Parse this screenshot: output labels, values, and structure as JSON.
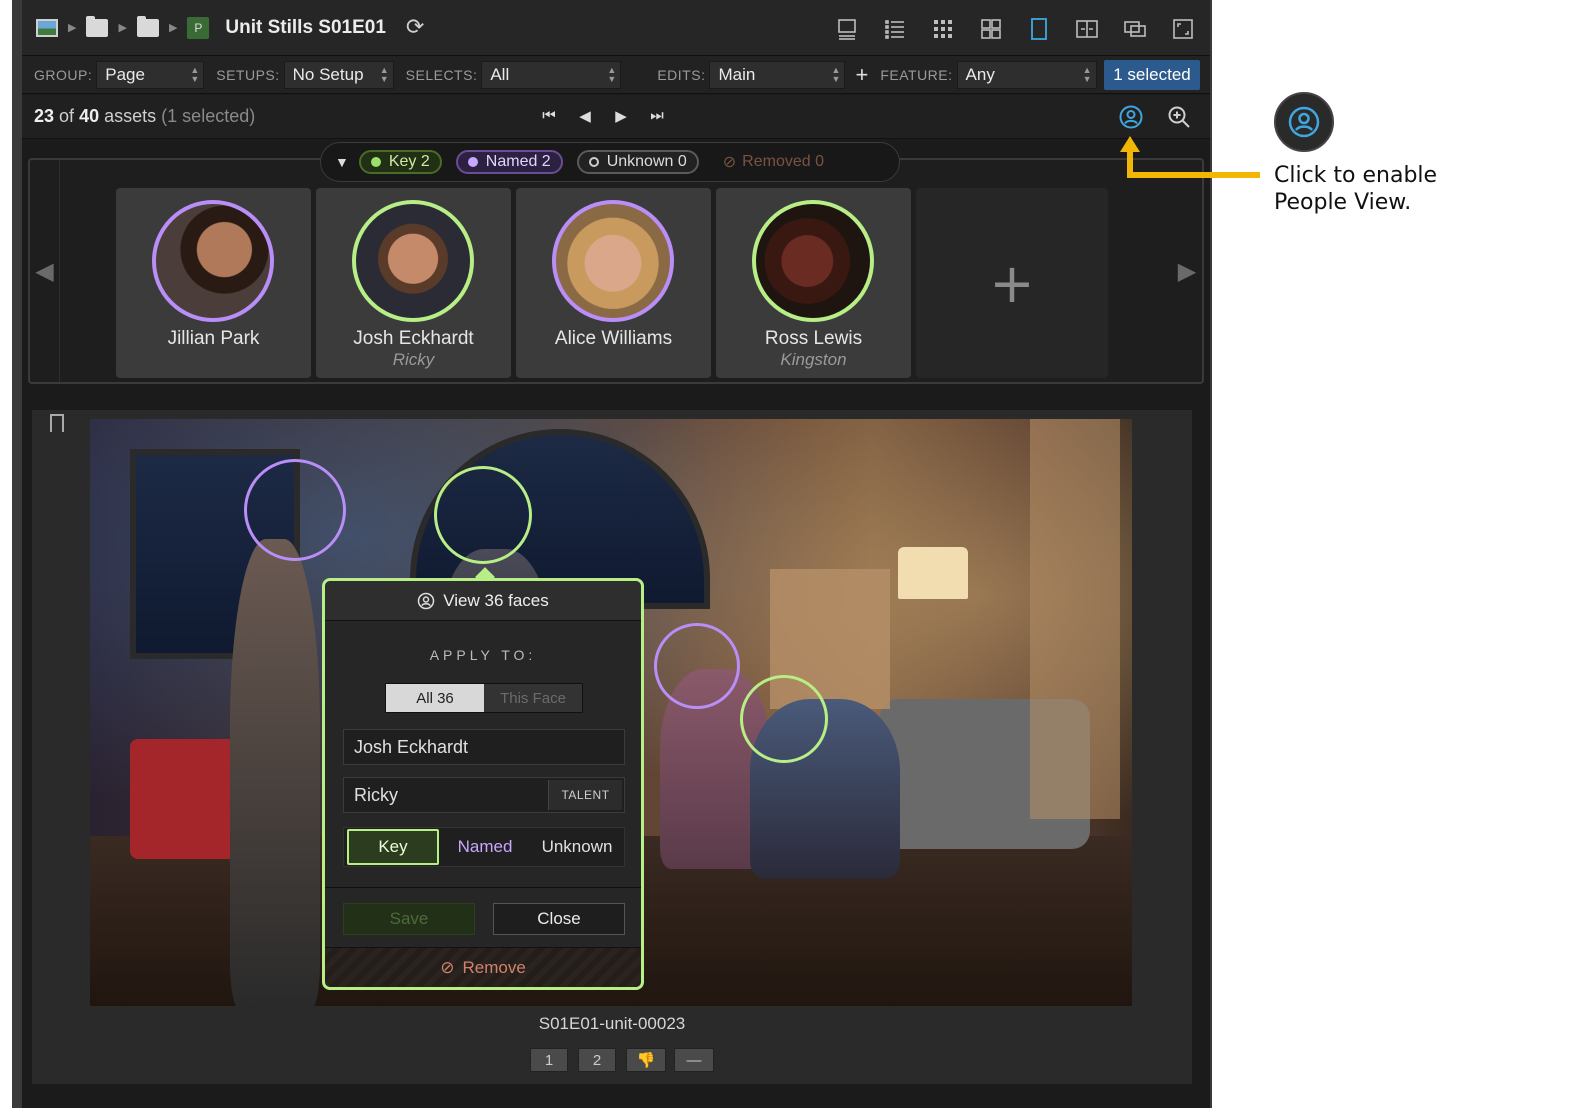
{
  "titlebar": {
    "title": "Unit Stills S01E01",
    "project_badge": "P"
  },
  "filters": {
    "group_label": "GROUP:",
    "group_value": "Page",
    "setups_label": "SETUPS:",
    "setups_value": "No Setup",
    "selects_label": "SELECTS:",
    "selects_value": "All",
    "edits_label": "EDITS:",
    "edits_value": "Main",
    "feature_label": "FEATURE:",
    "feature_value": "Any",
    "selected_button": "1 selected"
  },
  "nav": {
    "shown": "23",
    "of": "of",
    "total": "40",
    "assets": "assets",
    "selected_note": "(1 selected)"
  },
  "chips": {
    "key": "Key  2",
    "named": "Named  2",
    "unknown": "Unknown  0",
    "removed": "Removed  0"
  },
  "people": [
    {
      "name": "Jillian Park",
      "role": "",
      "type": "named"
    },
    {
      "name": "Josh Eckhardt",
      "role": "Ricky",
      "type": "key"
    },
    {
      "name": "Alice Williams",
      "role": "",
      "type": "named"
    },
    {
      "name": "Ross Lewis",
      "role": "Kingston",
      "type": "key"
    }
  ],
  "popover": {
    "header": "View 36 faces",
    "apply_to": "APPLY TO:",
    "seg_all": "All 36",
    "seg_face": "This Face",
    "name_value": "Josh Eckhardt",
    "role_value": "Ricky",
    "talent_label": "TALENT",
    "type_key": "Key",
    "type_named": "Named",
    "type_unknown": "Unknown",
    "save": "Save",
    "close": "Close",
    "remove": "Remove"
  },
  "asset": {
    "filename": "S01E01-unit-00023",
    "ratings": [
      "1",
      "2"
    ]
  },
  "callout": {
    "line1": "Click to enable",
    "line2": "People View."
  },
  "colors": {
    "key": "#b7ee86",
    "named": "#b98ef7",
    "accent": "#2d5a8c",
    "callout_arrow": "#f2b705"
  }
}
